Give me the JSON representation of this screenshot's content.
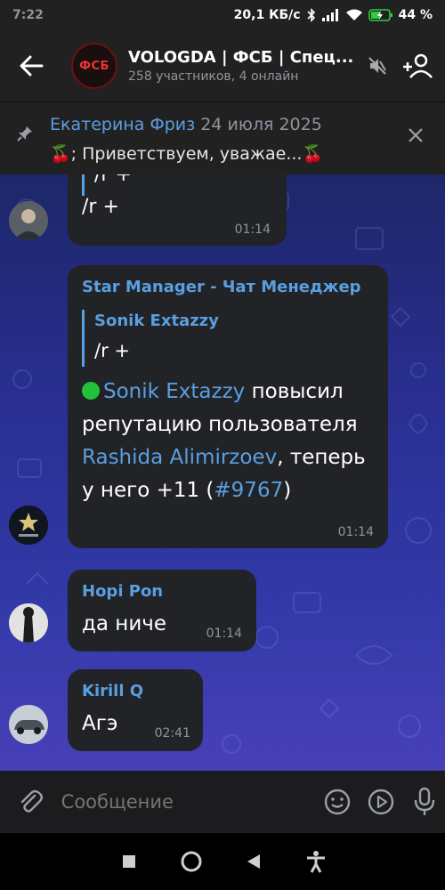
{
  "status": {
    "time": "7:22",
    "network_speed": "20,1 КБ/с",
    "battery": "44 %"
  },
  "header": {
    "title": "VOLOGDA | ФСБ | Спец...",
    "subtitle": "258 участников, 4 онлайн",
    "avatar_text": "ФСБ"
  },
  "pinned": {
    "author": "Екатерина Фриз",
    "date": "24 июля 2025",
    "text": "🍒; Приветствуем, уважае...🍒"
  },
  "messages": [
    {
      "quote_text": "/r +",
      "text": "/r +",
      "time": "01:14"
    },
    {
      "sender": "Star Manager - Чат Менеджер",
      "quote_name": "Sonik Extazzy",
      "quote_text": "/r +",
      "body_user": "Sonik Extazzy",
      "body_1": "повысил репутацию пользователя",
      "body_target": "Rashida Alimirzoev",
      "body_2": ", теперь у него +11 (",
      "body_tag": "#9767",
      "body_3": ")",
      "time": "01:14"
    },
    {
      "sender": "Hopi Pon",
      "text": "да ниче",
      "time": "01:14"
    },
    {
      "sender": "Kirill Q",
      "text": "Агэ",
      "time": "02:41"
    }
  ],
  "input": {
    "placeholder": "Сообщение"
  },
  "colors": {
    "accent": "#5a9fe0",
    "bubble": "#212327",
    "header": "#212121"
  }
}
